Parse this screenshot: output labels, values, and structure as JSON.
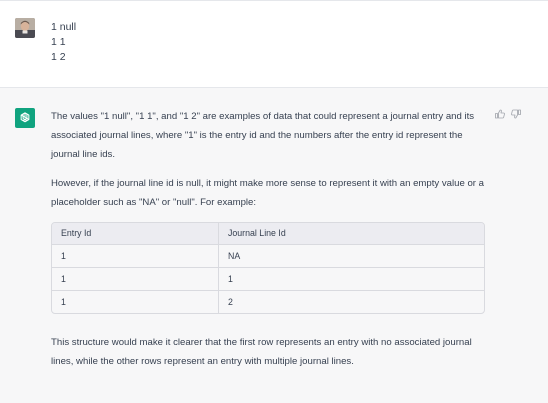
{
  "user_message": {
    "lines": [
      "1 null",
      "1 1",
      "1 2"
    ]
  },
  "assistant_message": {
    "paragraph_1": "The values \"1 null\", \"1 1\", and \"1 2\" are examples of data that could represent a journal entry and its associated journal lines, where \"1\" is the entry id and the numbers after the entry id represent the journal line ids.",
    "paragraph_2": "However, if the journal line id is null, it might make more sense to represent it with an empty value or a placeholder such as \"NA\" or \"null\". For example:",
    "table": {
      "headers": [
        "Entry Id",
        "Journal Line Id"
      ],
      "rows": [
        [
          "1",
          "NA"
        ],
        [
          "1",
          "1"
        ],
        [
          "1",
          "2"
        ]
      ]
    },
    "paragraph_3": "This structure would make it clearer that the first row represents an entry with no associated journal lines, while the other rows represent an entry with multiple journal lines."
  },
  "icons": {
    "user_avatar": "user-avatar-photo",
    "assistant_avatar": "openai-logo-icon",
    "thumbs_up": "thumbs-up-icon",
    "thumbs_down": "thumbs-down-icon"
  },
  "colors": {
    "assistant_bg": "#f7f7f8",
    "brand_green": "#10a37f",
    "text": "#374151"
  }
}
